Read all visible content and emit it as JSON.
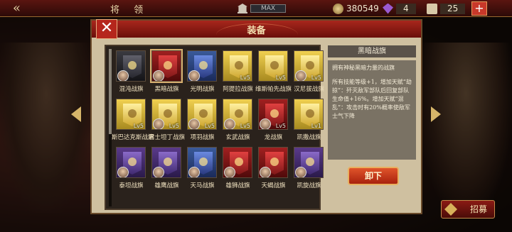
{
  "topbar": {
    "back_label": "«",
    "title": "将 领",
    "max_label": "MAX",
    "coins": "380549",
    "gems": "4",
    "scrolls": "25",
    "plus_label": "+"
  },
  "recruit_label": "招募",
  "modal": {
    "title": "装备",
    "close_label": "✕",
    "unequip_label": "卸下",
    "detail": {
      "name": "黑暗战旗",
      "desc": "拥有神秘黑暗力量的战旗",
      "effect": "所有技能等级+1，增加天赋“劫掠”：歼灭敌军部队后回复部队生命值+16%。增加天赋“混乱”：攻击时有20%概率使敌军士气下降"
    },
    "items": [
      {
        "name": "混沌战旗",
        "color": "black",
        "level": "",
        "portrait": true
      },
      {
        "name": "黑暗战旗",
        "color": "crimson",
        "level": "",
        "portrait": true,
        "selected": true
      },
      {
        "name": "光明战旗",
        "color": "blue",
        "level": "",
        "portrait": true
      },
      {
        "name": "阿提拉战旗",
        "color": "yellow",
        "level": "Lv5",
        "portrait": false
      },
      {
        "name": "维斯帕先战旗",
        "color": "yellow",
        "level": "Lv5",
        "portrait": false
      },
      {
        "name": "汉尼拔战旗",
        "color": "yellow",
        "level": "Lv5",
        "portrait": true
      },
      {
        "name": "斯巴达克斯战旗",
        "color": "yellow",
        "level": "Lv5",
        "portrait": false
      },
      {
        "name": "君士坦丁战旗",
        "color": "yellow",
        "level": "Lv5",
        "portrait": true
      },
      {
        "name": "项羽战旗",
        "color": "yellow",
        "level": "Lv5",
        "portrait": true
      },
      {
        "name": "玄武战旗",
        "color": "yellow",
        "level": "Lv5",
        "portrait": true
      },
      {
        "name": "龙战旗",
        "color": "crimson",
        "level": "Lv5",
        "portrait": true
      },
      {
        "name": "凯撒战旗",
        "color": "yellow",
        "level": "Lv1",
        "portrait": false
      },
      {
        "name": "泰坦战旗",
        "color": "purple",
        "level": "",
        "portrait": true
      },
      {
        "name": "雄鹰战旗",
        "color": "purple",
        "level": "",
        "portrait": true
      },
      {
        "name": "天马战旗",
        "color": "blue",
        "level": "",
        "portrait": true
      },
      {
        "name": "雄狮战旗",
        "color": "crimson",
        "level": "",
        "portrait": true
      },
      {
        "name": "天蝎战旗",
        "color": "crimson",
        "level": "",
        "portrait": true
      },
      {
        "name": "凯旋战旗",
        "color": "purple",
        "level": "",
        "portrait": true
      }
    ]
  }
}
